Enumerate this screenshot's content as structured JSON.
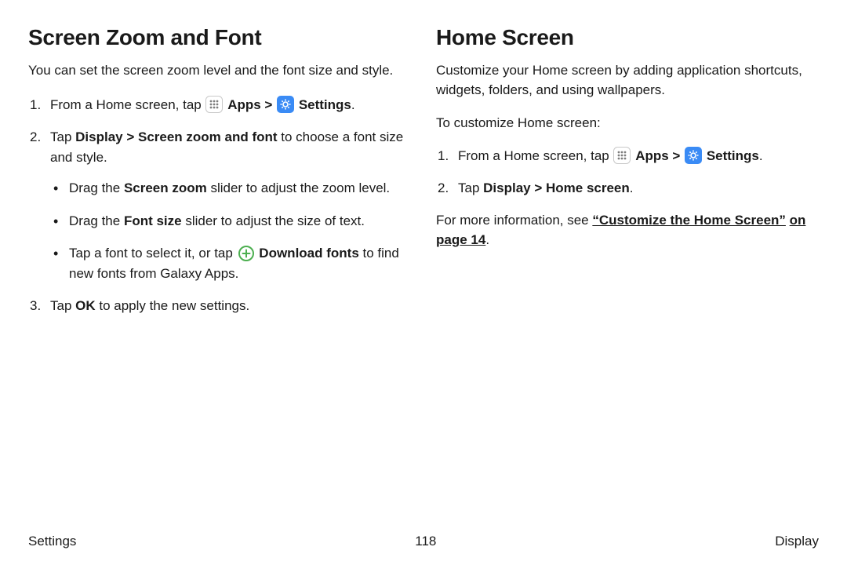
{
  "left": {
    "heading": "Screen Zoom and Font",
    "lead": "You can set the screen zoom level and the font size and style.",
    "step1_pre": "From a Home screen, tap ",
    "apps_label": "Apps",
    "chevron": " > ",
    "settings_label": "Settings",
    "period": ".",
    "step2_a": "Tap ",
    "step2_b": "Display > Screen zoom and font",
    "step2_c": " to choose a font size and style.",
    "b1_a": "Drag the ",
    "b1_b": "Screen zoom",
    "b1_c": " slider to adjust the zoom level.",
    "b2_a": "Drag the ",
    "b2_b": "Font size",
    "b2_c": " slider to adjust the size of text.",
    "b3_a": "Tap a font to select it, or tap ",
    "b3_b": "Download fonts",
    "b3_c": " to find new fonts from Galaxy Apps.",
    "step3_a": "Tap ",
    "step3_b": "OK",
    "step3_c": " to apply the new settings."
  },
  "right": {
    "heading": "Home Screen",
    "lead": "Customize your Home screen by adding application shortcuts, widgets, folders, and using wallpapers.",
    "intro": "To customize Home screen:",
    "step1_pre": "From a Home screen, tap ",
    "apps_label": "Apps",
    "chevron": " > ",
    "settings_label": "Settings",
    "period": ".",
    "step2_a": "Tap ",
    "step2_b": "Display > Home screen",
    "step2_c": ".",
    "more_a": "For more information, see ",
    "more_link1": "“Customize the Home Screen”",
    "more_link2": "on page 14",
    "more_c": "."
  },
  "footer": {
    "left": "Settings",
    "center": "118",
    "right": "Display"
  }
}
